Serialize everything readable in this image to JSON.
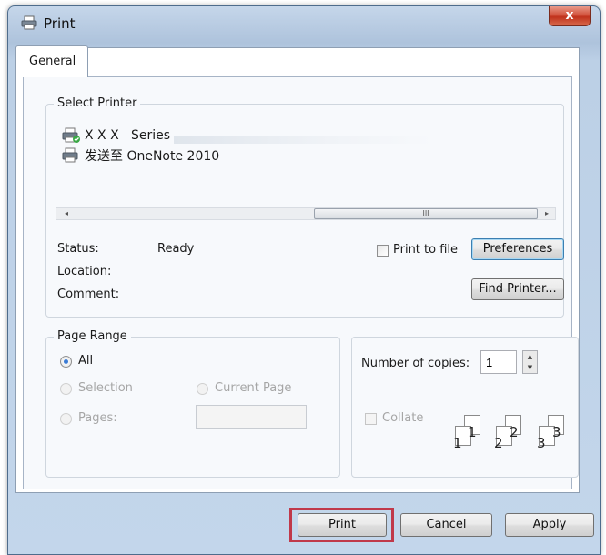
{
  "window": {
    "title": "Print",
    "close_glyph": "x"
  },
  "tabs": [
    {
      "label": "General",
      "selected": true
    }
  ],
  "select_printer": {
    "legend": "Select Printer",
    "printers": [
      {
        "name": "X X X   Series",
        "icon": "printer-default-icon",
        "selected": true
      },
      {
        "name": "发送至 OneNote 2010",
        "icon": "printer-icon"
      }
    ],
    "scrollbar": {
      "thumb_grip": "III",
      "left_arrow": "◂",
      "right_arrow": "▸"
    },
    "status_label": "Status:",
    "status_value": "Ready",
    "location_label": "Location:",
    "comment_label": "Comment:",
    "print_to_file": "Print to file",
    "preferences_button": "Preferences",
    "find_printer_button": "Find Printer..."
  },
  "page_range": {
    "legend": "Page Range",
    "all": "All",
    "selection": "Selection",
    "current_page": "Current Page",
    "pages": "Pages:",
    "pages_value": ""
  },
  "copies": {
    "label": "Number of copies:",
    "value": "1",
    "collate": "Collate",
    "collate_pages": [
      "1",
      "1",
      "2",
      "2",
      "3",
      "3"
    ]
  },
  "footer": {
    "print_button": "Print",
    "cancel_button": "Cancel",
    "apply_button": "Apply"
  },
  "colors": {
    "highlight": "#c0394a",
    "titlebar": "#aec3dc",
    "close": "#c0321c"
  }
}
